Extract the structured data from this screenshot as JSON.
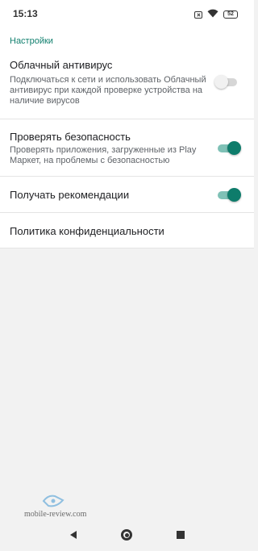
{
  "status_bar": {
    "time": "15:13",
    "battery": "52",
    "icons": [
      "sim-off-icon",
      "wifi-icon",
      "battery-icon"
    ]
  },
  "settings": {
    "section_header": "Настройки",
    "items": [
      {
        "title": "Облачный антивирус",
        "summary": "Подключаться к сети и использовать Облачный антивирус при каждой проверке устройства на наличие вирусов",
        "toggle": "off"
      },
      {
        "title": "Проверять безопасность",
        "summary": "Проверять приложения, загруженные из Play Маркет, на проблемы с безопасностью",
        "toggle": "on"
      },
      {
        "title": "Получать рекомендации",
        "toggle": "on"
      },
      {
        "title": "Политика конфиденциальности"
      }
    ]
  },
  "watermark": {
    "text": "mobile-review.com"
  },
  "navigation": {
    "icons": [
      "back-icon",
      "home-icon",
      "recents-icon"
    ]
  },
  "colors": {
    "accent": "#0e7c6b",
    "header": "#12806f",
    "track_on": "#7fc1b6",
    "track_off": "#d6d6d6"
  }
}
